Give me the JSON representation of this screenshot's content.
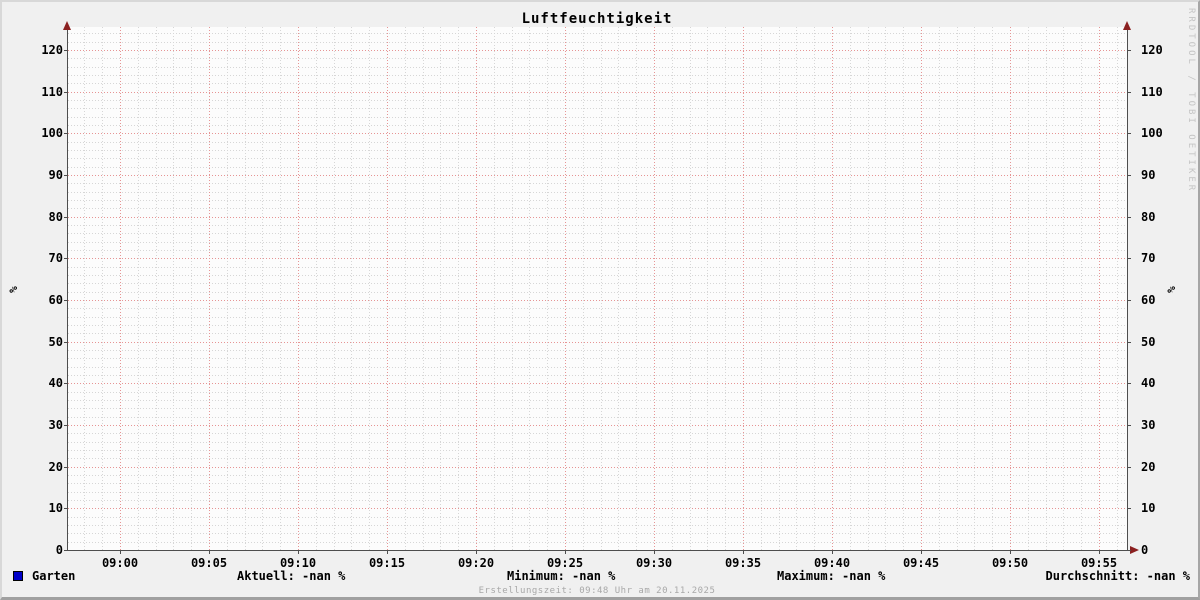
{
  "chart_data": {
    "type": "line",
    "title": "Luftfeuchtigkeit",
    "xlabel": "",
    "ylabel": "%",
    "ylim": [
      0,
      125
    ],
    "y_ticks": [
      0,
      10,
      20,
      30,
      40,
      50,
      60,
      70,
      80,
      90,
      100,
      110,
      120
    ],
    "y_minor_step": 2,
    "x_ticks": [
      "09:00",
      "09:05",
      "09:10",
      "09:15",
      "09:20",
      "09:25",
      "09:30",
      "09:35",
      "09:40",
      "09:45",
      "09:50",
      "09:55"
    ],
    "x_minor_step_minutes": 1,
    "grid": true,
    "legend_position": "bottom",
    "series": [
      {
        "name": "Garten",
        "color": "#0000c8",
        "values": []
      }
    ]
  },
  "legend": {
    "series_label": "Garten",
    "aktuell": "Aktuell: -nan %",
    "minimum": "Minimum: -nan %",
    "maximum": "Maximum: -nan %",
    "durchschnitt": "Durchschnitt: -nan %"
  },
  "footer": "Erstellungszeit: 09:48 Uhr am 20.11.2025",
  "watermark": "RRDTOOL / TOBI OETIKER",
  "colors": {
    "background": "#f0f0f0",
    "canvas": "#fcfcfc",
    "grid_major": "#e69494",
    "grid_minor": "#d6d6d6",
    "axis": "#4d4d4d",
    "arrow": "#8b2020",
    "series": "#0000c8",
    "footer_text": "#a8a8a8",
    "watermark_text": "#c4c4c4"
  }
}
